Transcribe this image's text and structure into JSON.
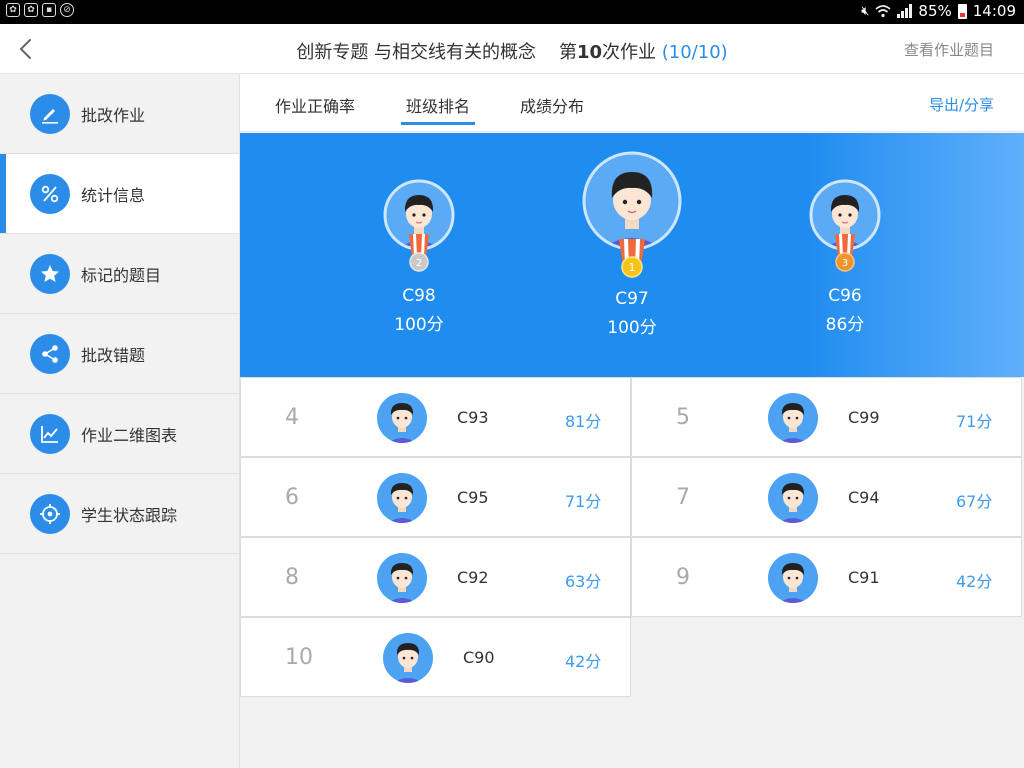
{
  "status_bar": {
    "battery": "85%",
    "time": "14:09"
  },
  "header": {
    "title_prefix": "创新专题 与相交线有关的概念",
    "title_num_pre": "第",
    "title_num": "10",
    "title_num_post": "次作业",
    "title_count": "(10/10)",
    "view_questions": "查看作业题目"
  },
  "sidebar": {
    "items": [
      {
        "label": "批改作业",
        "icon": "pencil-icon"
      },
      {
        "label": "统计信息",
        "icon": "percent-icon"
      },
      {
        "label": "标记的题目",
        "icon": "star-icon"
      },
      {
        "label": "批改错题",
        "icon": "share-icon"
      },
      {
        "label": "作业二维图表",
        "icon": "line-chart-icon"
      },
      {
        "label": "学生状态跟踪",
        "icon": "target-icon"
      }
    ]
  },
  "tabs": {
    "items": [
      "作业正确率",
      "班级排名",
      "成绩分布"
    ],
    "active": "班级排名",
    "export": "导出/分享"
  },
  "podium": {
    "first": {
      "name": "C97",
      "score": "100分",
      "medal": "1"
    },
    "second": {
      "name": "C98",
      "score": "100分",
      "medal": "2"
    },
    "third": {
      "name": "C96",
      "score": "86分",
      "medal": "3"
    }
  },
  "ranking": [
    {
      "rank": "4",
      "name": "C93",
      "score": "81分"
    },
    {
      "rank": "5",
      "name": "C99",
      "score": "71分"
    },
    {
      "rank": "6",
      "name": "C95",
      "score": "71分"
    },
    {
      "rank": "7",
      "name": "C94",
      "score": "67分"
    },
    {
      "rank": "8",
      "name": "C92",
      "score": "63分"
    },
    {
      "rank": "9",
      "name": "C91",
      "score": "42分"
    },
    {
      "rank": "10",
      "name": "C90",
      "score": "42分"
    }
  ],
  "colors": {
    "accent": "#2b8de8",
    "podium_bg": "#1f8cf0",
    "score": "#3d9cf0",
    "medal_gold": "#f5c31a",
    "medal_silver": "#c9c9c9",
    "medal_bronze": "#f0932b"
  }
}
